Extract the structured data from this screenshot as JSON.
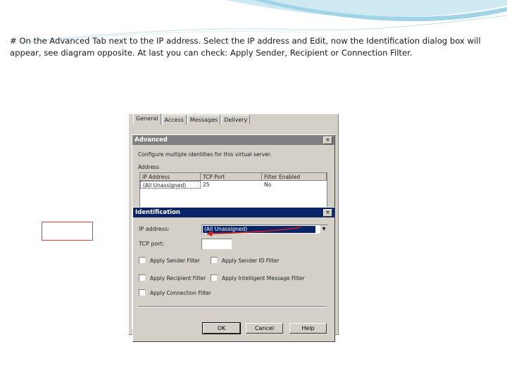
{
  "slide": {
    "caption": "# On the Advanced Tab next to the IP address.  Select the IP address and Edit, now the Identification dialog box will appear, see diagram opposite.  At last you can check: Apply Sender, Recipient or Connection Filter."
  },
  "colors": {
    "accent_swoosh": "#9fd3e8",
    "titlebar_active": "#0a246a",
    "titlebar_inactive": "#808080",
    "highlight_box": "#d94040",
    "arrow": "#d22020"
  },
  "properties_window": {
    "tabs": [
      "General",
      "Access",
      "Messages",
      "Delivery"
    ]
  },
  "advanced_dialog": {
    "title": "Advanced",
    "close_label": "×",
    "description": "Configure multiple identities for this virtual server.",
    "address_label": "Address",
    "columns": [
      "IP Address",
      "TCP Port",
      "Filter Enabled"
    ],
    "rows": [
      {
        "ip": "(All Unassigned)",
        "port": "25",
        "filter": "No"
      }
    ]
  },
  "identification_dialog": {
    "title": "Identification",
    "close_label": "×",
    "ip_label": "IP address:",
    "ip_value": "(All Unassigned)",
    "dropdown_icon": "triangle-down",
    "tcp_label": "TCP port:",
    "tcp_value": "",
    "checkboxes": {
      "sender": "Apply Sender Filter",
      "sender_id": "Apply Sender ID Filter",
      "recipient": "Apply Recipient Filter",
      "intelligent": "Apply Intelligent Message Filter",
      "connection": "Apply Connection Filter"
    },
    "buttons": {
      "ok": "OK",
      "cancel": "Cancel",
      "help": "Help"
    }
  }
}
